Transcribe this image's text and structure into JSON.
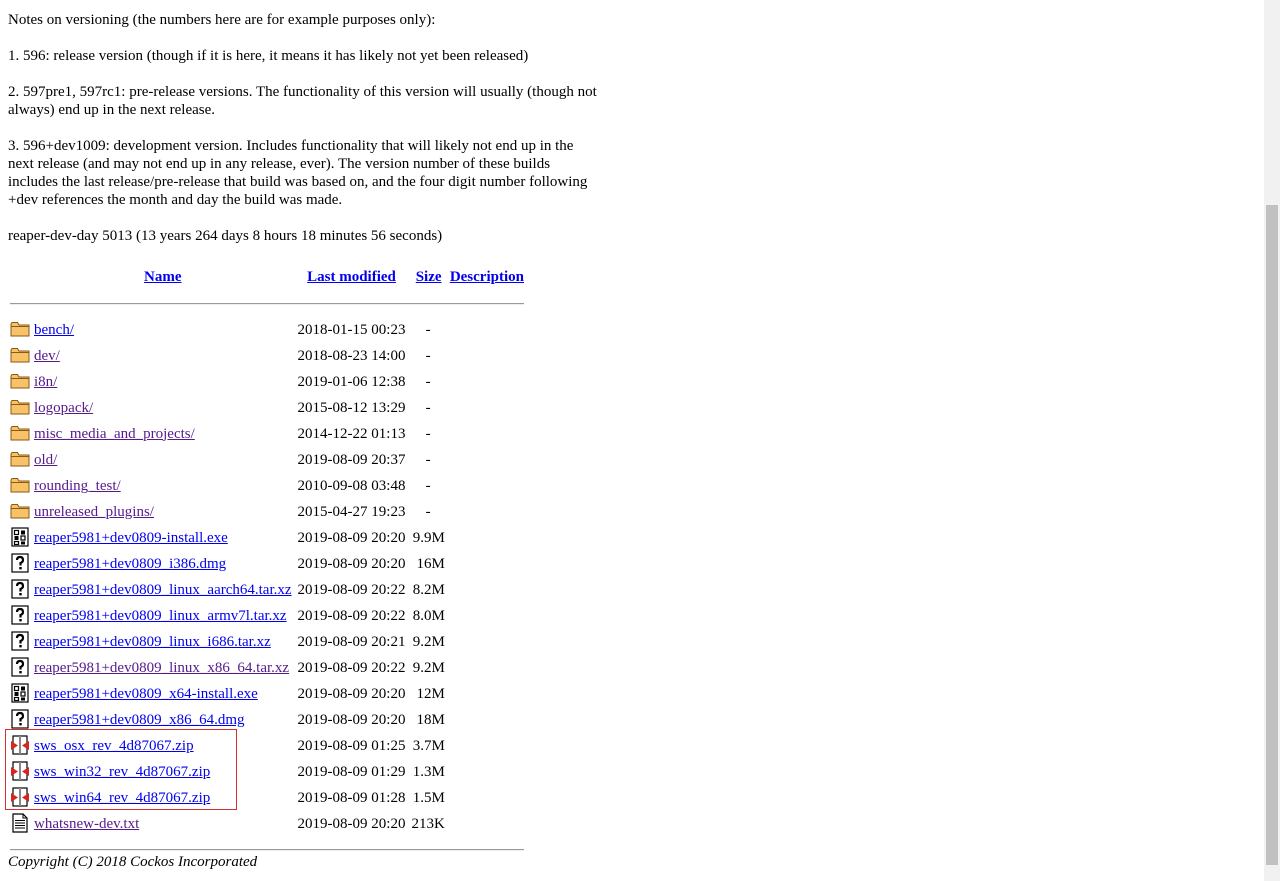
{
  "notes": {
    "header": "Notes on versioning (the numbers here are for example purposes only):",
    "item1": "1. 596: release version (though if it is here, it means it has likely not yet been released)",
    "item2": "2. 597pre1, 597rc1: pre-release versions. The functionality of this version will usually (though not always) end up in the next release.",
    "item3": "3. 596+dev1009: development version. Includes functionality that will likely not end up in the next release (and may not end up in any release, ever). The version number of these builds includes the last release/pre-release that build was based on, and the four digit number following +dev references the month and day the build was made.",
    "status": "reaper-dev-day 5013 (13 years 264 days 8 hours 18 minutes 56 seconds)"
  },
  "listing": {
    "columns": {
      "name": "Name",
      "last_modified": "Last modified",
      "size": "Size",
      "description": "Description"
    },
    "rows": [
      {
        "icon": "folder-icon",
        "name": "bench/",
        "modified": "2018-01-15 00:23",
        "size": "-",
        "visited": false
      },
      {
        "icon": "folder-icon",
        "name": "dev/",
        "modified": "2018-08-23 14:00",
        "size": "-",
        "visited": true
      },
      {
        "icon": "folder-icon",
        "name": "i8n/",
        "modified": "2019-01-06 12:38",
        "size": "-",
        "visited": true
      },
      {
        "icon": "folder-icon",
        "name": "logopack/",
        "modified": "2015-08-12 13:29",
        "size": "-",
        "visited": true
      },
      {
        "icon": "folder-icon",
        "name": "misc_media_and_projects/",
        "modified": "2014-12-22 01:13",
        "size": "-",
        "visited": true
      },
      {
        "icon": "folder-icon",
        "name": "old/",
        "modified": "2019-08-09 20:37",
        "size": "-",
        "visited": true
      },
      {
        "icon": "folder-icon",
        "name": "rounding_test/",
        "modified": "2010-09-08 03:48",
        "size": "-",
        "visited": true
      },
      {
        "icon": "folder-icon",
        "name": "unreleased_plugins/",
        "modified": "2015-04-27 19:23",
        "size": "-",
        "visited": true
      },
      {
        "icon": "binary-file-icon",
        "name": "reaper5981+dev0809-install.exe",
        "modified": "2019-08-09 20:20",
        "size": "9.9M",
        "visited": false
      },
      {
        "icon": "unknown-file-icon",
        "name": "reaper5981+dev0809_i386.dmg",
        "modified": "2019-08-09 20:20",
        "size": "16M",
        "visited": false
      },
      {
        "icon": "unknown-file-icon",
        "name": "reaper5981+dev0809_linux_aarch64.tar.xz",
        "modified": "2019-08-09 20:22",
        "size": "8.2M",
        "visited": false
      },
      {
        "icon": "unknown-file-icon",
        "name": "reaper5981+dev0809_linux_armv7l.tar.xz",
        "modified": "2019-08-09 20:22",
        "size": "8.0M",
        "visited": false
      },
      {
        "icon": "unknown-file-icon",
        "name": "reaper5981+dev0809_linux_i686.tar.xz",
        "modified": "2019-08-09 20:21",
        "size": "9.2M",
        "visited": false
      },
      {
        "icon": "unknown-file-icon",
        "name": "reaper5981+dev0809_linux_x86_64.tar.xz",
        "modified": "2019-08-09 20:22",
        "size": "9.2M",
        "visited": true
      },
      {
        "icon": "binary-file-icon",
        "name": "reaper5981+dev0809_x64-install.exe",
        "modified": "2019-08-09 20:20",
        "size": "12M",
        "visited": false
      },
      {
        "icon": "unknown-file-icon",
        "name": "reaper5981+dev0809_x86_64.dmg",
        "modified": "2019-08-09 20:20",
        "size": "18M",
        "visited": false
      },
      {
        "icon": "compressed-file-icon",
        "name": "sws_osx_rev_4d87067.zip",
        "modified": "2019-08-09 01:25",
        "size": "3.7M",
        "visited": false
      },
      {
        "icon": "compressed-file-icon",
        "name": "sws_win32_rev_4d87067.zip",
        "modified": "2019-08-09 01:29",
        "size": "1.3M",
        "visited": false
      },
      {
        "icon": "compressed-file-icon",
        "name": "sws_win64_rev_4d87067.zip",
        "modified": "2019-08-09 01:28",
        "size": "1.5M",
        "visited": false
      },
      {
        "icon": "text-file-icon",
        "name": "whatsnew-dev.txt",
        "modified": "2019-08-09 20:20",
        "size": "213K",
        "visited": true
      }
    ]
  },
  "footer": "Copyright (C) 2018 Cockos Incorporated",
  "colors": {
    "link": "#0000ee",
    "visited_link": "#551a8b",
    "highlight_border": "#d62f2f"
  }
}
